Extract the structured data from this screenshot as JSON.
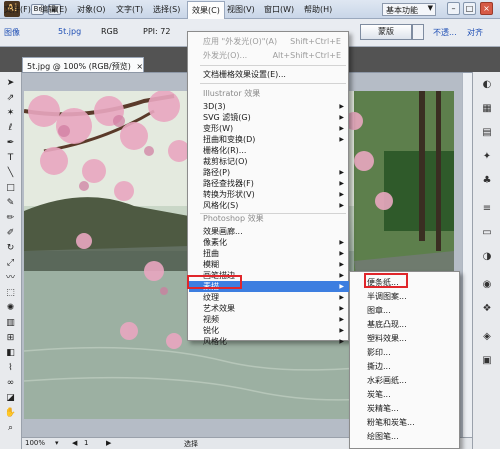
{
  "menubar": {
    "logo": "Ai",
    "items": [
      {
        "id": "file",
        "label": "文件(F)"
      },
      {
        "id": "edit",
        "label": "编辑(E)"
      },
      {
        "id": "object",
        "label": "对象(O)"
      },
      {
        "id": "type",
        "label": "文字(T)"
      },
      {
        "id": "select",
        "label": "选择(S)"
      },
      {
        "id": "effect",
        "label": "效果(C)"
      },
      {
        "id": "view",
        "label": "视图(V)"
      },
      {
        "id": "window",
        "label": "窗口(W)"
      },
      {
        "id": "help",
        "label": "帮助(H)"
      }
    ],
    "workspace": "基本功能"
  },
  "controlbar": {
    "image_label": "图像",
    "filename": "5t.jpg",
    "color_mode": "RGB",
    "ppi": "PPI: 72",
    "mask_button": "蒙版",
    "opacity_link": "不透...",
    "align_link": "对齐"
  },
  "document": {
    "tab_title": "5t.jpg @ 100% (RGB/预览)",
    "tab_close": "×"
  },
  "statusbar": {
    "zoom": "100%",
    "page": "1",
    "tool": "选择"
  },
  "effect_menu": {
    "items": [
      {
        "label": "应用 \"外发光(O)\"(A)",
        "shortcut": "Shift+Ctrl+E",
        "state": "disabled"
      },
      {
        "label": "外发光(O)...",
        "shortcut": "Alt+Shift+Ctrl+E",
        "state": "disabled"
      },
      {
        "label": "文档栅格效果设置(E)...",
        "state": "normal"
      },
      {
        "label": "Illustrator 效果",
        "state": "heading"
      },
      {
        "label": "3D(3)",
        "state": "submenu"
      },
      {
        "label": "SVG 滤镜(G)",
        "state": "submenu"
      },
      {
        "label": "变形(W)",
        "state": "submenu"
      },
      {
        "label": "扭曲和变换(D)",
        "state": "submenu"
      },
      {
        "label": "栅格化(R)...",
        "state": "normal"
      },
      {
        "label": "裁剪标记(O)",
        "state": "normal"
      },
      {
        "label": "路径(P)",
        "state": "submenu"
      },
      {
        "label": "路径查找器(F)",
        "state": "submenu"
      },
      {
        "label": "转换为形状(V)",
        "state": "submenu"
      },
      {
        "label": "风格化(S)",
        "state": "submenu"
      },
      {
        "label": "Photoshop 效果",
        "state": "heading"
      },
      {
        "label": "效果画廊...",
        "state": "normal"
      },
      {
        "label": "像素化",
        "state": "submenu"
      },
      {
        "label": "扭曲",
        "state": "submenu"
      },
      {
        "label": "模糊",
        "state": "submenu"
      },
      {
        "label": "画笔描边",
        "state": "submenu"
      },
      {
        "label": "素描",
        "state": "highlighted"
      },
      {
        "label": "纹理",
        "state": "submenu"
      },
      {
        "label": "艺术效果",
        "state": "submenu"
      },
      {
        "label": "视频",
        "state": "submenu"
      },
      {
        "label": "锐化",
        "state": "submenu"
      },
      {
        "label": "风格化",
        "state": "submenu"
      }
    ]
  },
  "sketch_menu": {
    "items": [
      "便条纸...",
      "半调图案...",
      "图章...",
      "基底凸现...",
      "塑料效果...",
      "影印...",
      "撕边...",
      "水彩画纸...",
      "炭笔...",
      "炭精笔...",
      "粉笔和炭笔...",
      "绘图笔..."
    ]
  },
  "colors": {
    "highlight": "#3d7ee0",
    "annotation": "#e0262b",
    "link": "#1f4fb5"
  }
}
